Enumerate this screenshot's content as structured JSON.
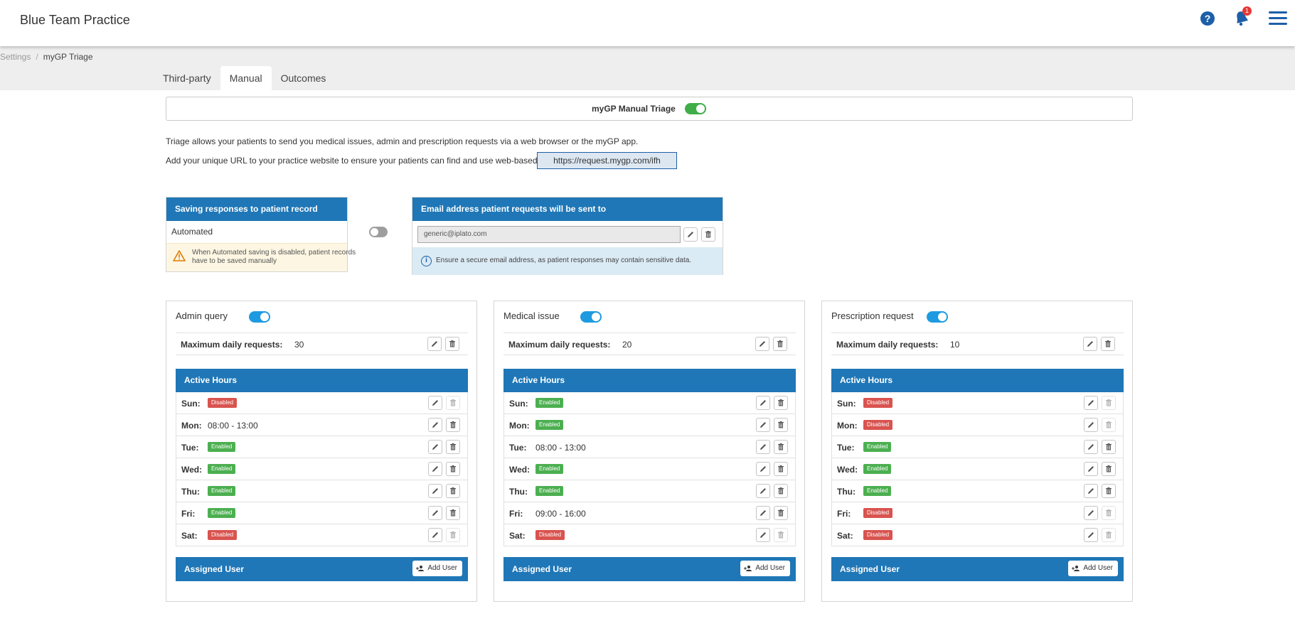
{
  "header": {
    "app_title": "Blue Team Practice",
    "notification_count": "1"
  },
  "breadcrumb": {
    "root": "Settings",
    "separator": "/",
    "current": "myGP Triage"
  },
  "tabs": [
    {
      "label": "Third-party",
      "active": false
    },
    {
      "label": "Manual",
      "active": true
    },
    {
      "label": "Outcomes",
      "active": false
    }
  ],
  "manual_triage": {
    "label": "myGP Manual Triage",
    "enabled": true
  },
  "intro": {
    "line1": "Triage allows your patients to send you medical issues, admin and prescription requests via a web browser or the myGP app.",
    "line2": "Add your unique URL to your practice website to ensure your patients can find and use web-based Triage:",
    "url": "https://request.mygp.com/ifh"
  },
  "saving_panel": {
    "title": "Saving responses to patient record",
    "automated_label": "Automated",
    "automated_enabled": false,
    "warning": "When Automated saving is disabled, patient records have to be saved manually"
  },
  "email_panel": {
    "title": "Email address patient requests will be sent to",
    "email": "generic@iplato.com",
    "info": "Ensure a secure email address, as patient responses may contain sensitive data."
  },
  "labels": {
    "max_daily": "Maximum daily requests:",
    "active_hours": "Active Hours",
    "assigned_user": "Assigned User",
    "add_user": "Add User"
  },
  "categories": [
    {
      "title": "Admin query",
      "enabled": true,
      "max_daily": "30",
      "hours": [
        {
          "day": "Sun:",
          "type": "status",
          "value": "Disabled"
        },
        {
          "day": "Mon:",
          "type": "time",
          "value": "08:00 - 13:00"
        },
        {
          "day": "Tue:",
          "type": "status",
          "value": "Enabled"
        },
        {
          "day": "Wed:",
          "type": "status",
          "value": "Enabled"
        },
        {
          "day": "Thu:",
          "type": "status",
          "value": "Enabled"
        },
        {
          "day": "Fri:",
          "type": "status",
          "value": "Enabled"
        },
        {
          "day": "Sat:",
          "type": "status",
          "value": "Disabled"
        }
      ]
    },
    {
      "title": "Medical issue",
      "enabled": true,
      "max_daily": "20",
      "hours": [
        {
          "day": "Sun:",
          "type": "status",
          "value": "Enabled"
        },
        {
          "day": "Mon:",
          "type": "status",
          "value": "Enabled"
        },
        {
          "day": "Tue:",
          "type": "time",
          "value": "08:00 - 13:00"
        },
        {
          "day": "Wed:",
          "type": "status",
          "value": "Enabled"
        },
        {
          "day": "Thu:",
          "type": "status",
          "value": "Enabled"
        },
        {
          "day": "Fri:",
          "type": "time",
          "value": "09:00 - 16:00"
        },
        {
          "day": "Sat:",
          "type": "status",
          "value": "Disabled"
        }
      ]
    },
    {
      "title": "Prescription request",
      "enabled": true,
      "max_daily": "10",
      "hours": [
        {
          "day": "Sun:",
          "type": "status",
          "value": "Disabled"
        },
        {
          "day": "Mon:",
          "type": "status",
          "value": "Disabled"
        },
        {
          "day": "Tue:",
          "type": "status",
          "value": "Enabled"
        },
        {
          "day": "Wed:",
          "type": "status",
          "value": "Enabled"
        },
        {
          "day": "Thu:",
          "type": "status",
          "value": "Enabled"
        },
        {
          "day": "Fri:",
          "type": "status",
          "value": "Disabled"
        },
        {
          "day": "Sat:",
          "type": "status",
          "value": "Disabled"
        }
      ]
    }
  ],
  "colors": {
    "primary": "#1f77b7",
    "enabled": "#4caf50",
    "disabled": "#d9534f",
    "toggle_green": "#3fae49",
    "toggle_blue": "#1e9be0"
  },
  "icons": [
    "help-icon",
    "bell-icon",
    "hamburger-menu-icon",
    "warning-icon",
    "info-icon",
    "pencil-icon",
    "trash-icon",
    "add-user-icon"
  ]
}
